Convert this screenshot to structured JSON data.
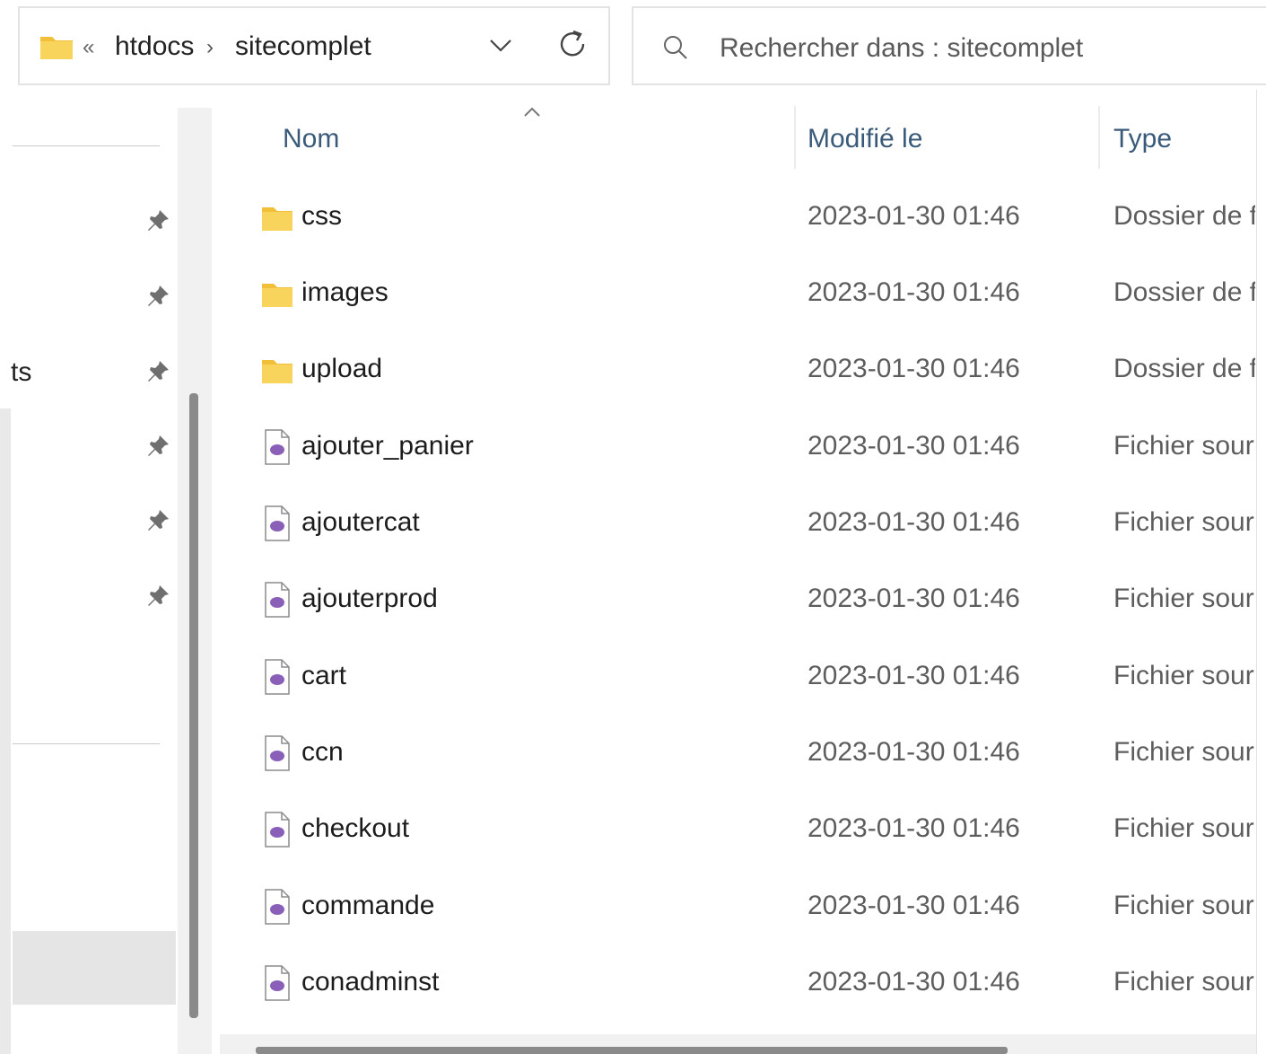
{
  "address_bar": {
    "overflow": "«",
    "crumbs": [
      "htdocs",
      "sitecomplet"
    ],
    "separator": "›"
  },
  "search": {
    "placeholder": "Rechercher dans : sitecomplet"
  },
  "nav": {
    "items": [
      {
        "label": ""
      },
      {
        "label": ""
      },
      {
        "label": "ts"
      },
      {
        "label": ""
      },
      {
        "label": ""
      },
      {
        "label": ""
      }
    ]
  },
  "columns": {
    "name": "Nom",
    "modified": "Modifié le",
    "type": "Type"
  },
  "files": [
    {
      "name": "css",
      "date": "2023-01-30 01:46",
      "type": "Dossier de fi",
      "icon": "folder-icon"
    },
    {
      "name": "images",
      "date": "2023-01-30 01:46",
      "type": "Dossier de fi",
      "icon": "folder-icon"
    },
    {
      "name": "upload",
      "date": "2023-01-30 01:46",
      "type": "Dossier de fi",
      "icon": "folder-icon"
    },
    {
      "name": "ajouter_panier",
      "date": "2023-01-30 01:46",
      "type": "Fichier sourc",
      "icon": "php-file-icon"
    },
    {
      "name": "ajoutercat",
      "date": "2023-01-30 01:46",
      "type": "Fichier sourc",
      "icon": "php-file-icon"
    },
    {
      "name": "ajouterprod",
      "date": "2023-01-30 01:46",
      "type": "Fichier sourc",
      "icon": "php-file-icon"
    },
    {
      "name": "cart",
      "date": "2023-01-30 01:46",
      "type": "Fichier sourc",
      "icon": "php-file-icon"
    },
    {
      "name": "ccn",
      "date": "2023-01-30 01:46",
      "type": "Fichier sourc",
      "icon": "php-file-icon"
    },
    {
      "name": "checkout",
      "date": "2023-01-30 01:46",
      "type": "Fichier sourc",
      "icon": "php-file-icon"
    },
    {
      "name": "commande",
      "date": "2023-01-30 01:46",
      "type": "Fichier sourc",
      "icon": "php-file-icon"
    },
    {
      "name": "conadminst",
      "date": "2023-01-30 01:46",
      "type": "Fichier sourc",
      "icon": "php-file-icon"
    }
  ],
  "colors": {
    "folder": "#f4c542",
    "php_icon": "#8a5fb8",
    "header_text": "#3a5a7a"
  }
}
